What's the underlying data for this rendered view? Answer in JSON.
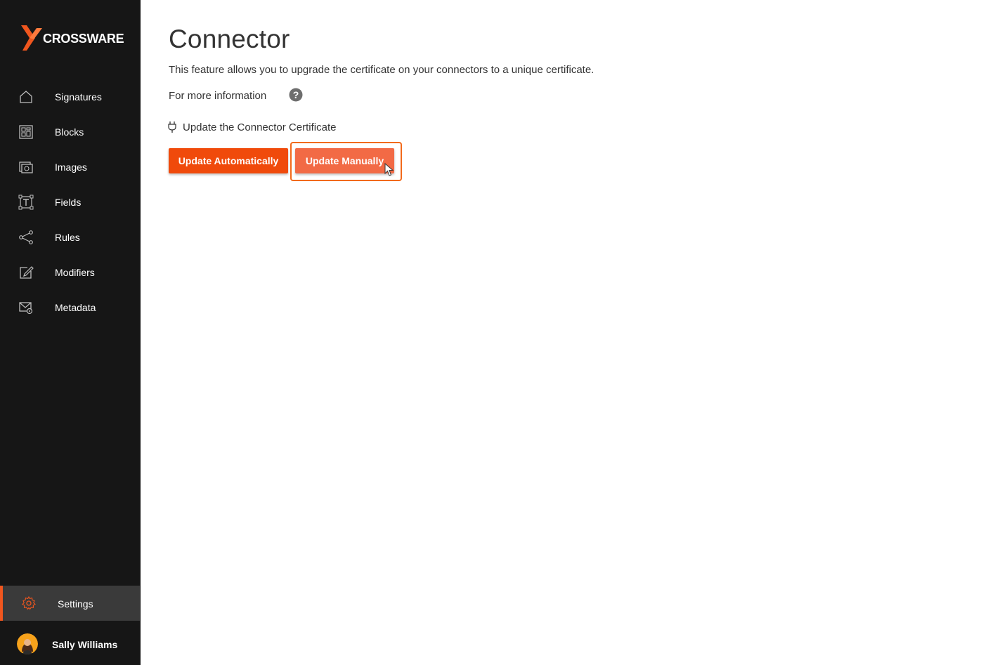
{
  "brand": {
    "name": "CROSSWARE",
    "accent_color": "#f0561e"
  },
  "sidebar": {
    "items": [
      {
        "label": "Signatures",
        "icon": "home-icon"
      },
      {
        "label": "Blocks",
        "icon": "blocks-icon"
      },
      {
        "label": "Images",
        "icon": "images-icon"
      },
      {
        "label": "Fields",
        "icon": "text-field-icon"
      },
      {
        "label": "Rules",
        "icon": "share-nodes-icon"
      },
      {
        "label": "Modifiers",
        "icon": "edit-icon"
      },
      {
        "label": "Metadata",
        "icon": "mail-settings-icon"
      }
    ],
    "settings": {
      "label": "Settings",
      "icon": "gear-icon"
    },
    "user": {
      "name": "Sally Williams"
    }
  },
  "main": {
    "title": "Connector",
    "description": "This feature allows you to upgrade the certificate on your connectors to a unique certificate.",
    "more_info": "For more information",
    "certificate_section": "Update the Connector Certificate",
    "buttons": {
      "auto": "Update Automatically",
      "manual": "Update Manually"
    }
  }
}
